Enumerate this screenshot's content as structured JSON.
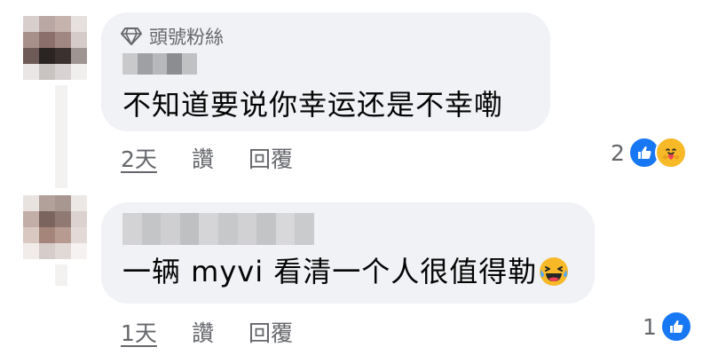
{
  "comments": [
    {
      "badge": "頭號粉絲",
      "author": "",
      "text": "不知道要说你幸运还是不幸嘞",
      "time": "2天",
      "like_label": "讚",
      "reply_label": "回覆",
      "reaction_count": "2",
      "reactions": [
        "like-icon",
        "care-icon"
      ],
      "author_redacted": true
    },
    {
      "badge": "",
      "author": "",
      "text": "一辆 myvi 看清一个人很值得勒",
      "trailing_emoji": "laughing-crying-emoji",
      "time": "1天",
      "like_label": "讚",
      "reply_label": "回覆",
      "reaction_count": "1",
      "reactions": [
        "like-icon"
      ],
      "author_redacted": true
    }
  ],
  "colors": {
    "bubble": "#f0f2f5",
    "meta_text": "#65676b",
    "text": "#050505",
    "like": "#1877f2",
    "care": "#f7b928"
  }
}
